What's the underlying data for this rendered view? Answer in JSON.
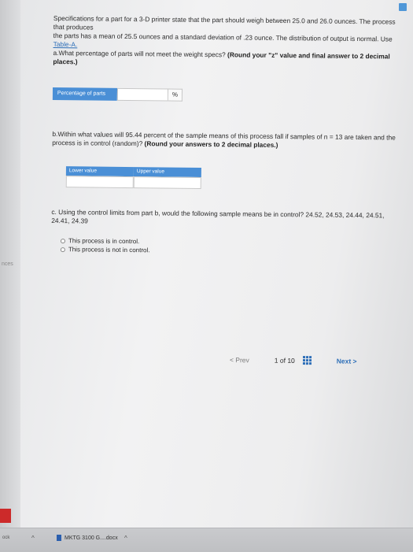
{
  "problem": {
    "line1": "Specifications for a part for a 3-D printer state that the part should weigh between 25.0 and 26.0 ounces. The process that produces",
    "line2_before_link": "the parts has a mean of 25.5 ounces and a standard deviation of .23 ounce. The distribution of output is normal. Use",
    "link": "Table-A.",
    "part_a_text": "a.What percentage of parts will not meet the weight specs?",
    "part_a_bold": "(Round your \"z\" value and final answer to 2 decimal places.)"
  },
  "part_a_answer": {
    "label": "Percentage of parts",
    "value": "",
    "unit": "%"
  },
  "part_b": {
    "text": "b.Within what values will 95.44 percent of the sample means of this process fall if samples of n = 13 are taken and the process is in control (random)?",
    "bold": "(Round your answers to 2 decimal places.)",
    "lower_label": "Lower value",
    "upper_label": "Upper value",
    "lower_value": "",
    "upper_value": ""
  },
  "part_c": {
    "text": "c. Using the control limits from part b, would the following sample means be in control? 24.52, 24.53, 24.44, 24.51, 24.41, 24.39",
    "options": [
      "This process is in control.",
      "This process is not in control."
    ]
  },
  "pager": {
    "prev": "< Prev",
    "page": "1 of 10",
    "next": "Next >"
  },
  "sidebar": {
    "edge_label": "nces"
  },
  "taskbar": {
    "left_label": "ock",
    "file_name": "MKTG 3100 G....docx"
  },
  "colors": {
    "accent": "#4a8fd6",
    "link": "#2e6fb8"
  }
}
